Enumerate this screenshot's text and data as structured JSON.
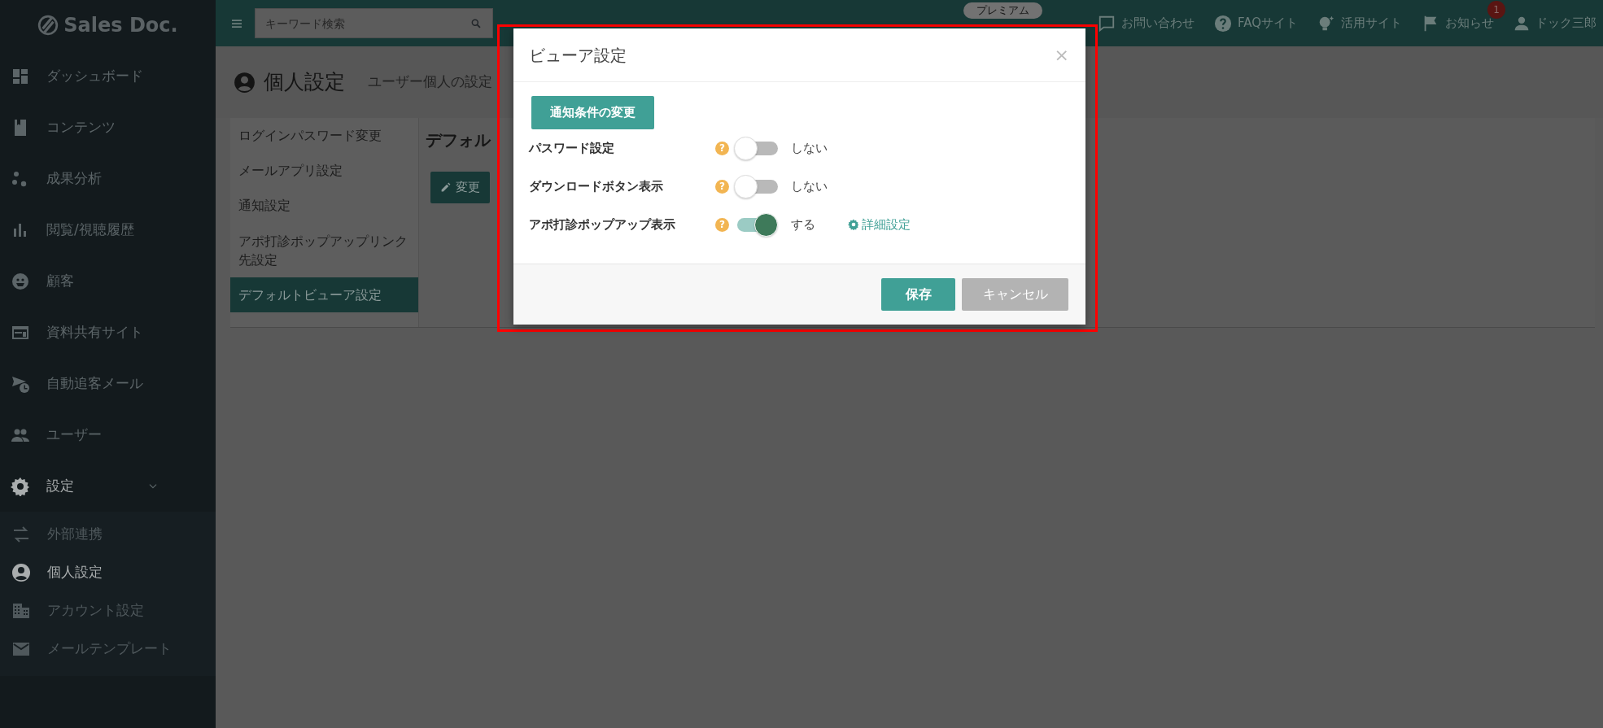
{
  "sidebar": {
    "logo": "Sales Doc.",
    "items": [
      {
        "label": "ダッシュボード"
      },
      {
        "label": "コンテンツ"
      },
      {
        "label": "成果分析"
      },
      {
        "label": "閲覧/視聴履歴"
      },
      {
        "label": "顧客"
      },
      {
        "label": "資料共有サイト"
      },
      {
        "label": "自動追客メール"
      },
      {
        "label": "ユーザー"
      }
    ],
    "settings": {
      "label": "設定",
      "expanded": true,
      "children": [
        {
          "label": "外部連携",
          "selected": false
        },
        {
          "label": "個人設定",
          "selected": true
        },
        {
          "label": "アカウント設定",
          "selected": false
        },
        {
          "label": "メールテンプレート",
          "selected": false
        }
      ]
    }
  },
  "topbar": {
    "search": {
      "placeholder": "キーワード検索"
    },
    "plan": "プレミアム",
    "links": [
      {
        "label": "お問い合わせ"
      },
      {
        "label": "FAQサイト"
      },
      {
        "label": "活用サイト"
      },
      {
        "label": "お知らせ",
        "badge": "1"
      }
    ],
    "user": "ドック三郎"
  },
  "page": {
    "title": "個人設定",
    "subtitle": "ユーザー個人の設定",
    "menu": [
      {
        "label": "ログインパスワード変更",
        "selected": false
      },
      {
        "label": "メールアプリ設定",
        "selected": false
      },
      {
        "label": "通知設定",
        "selected": false
      },
      {
        "label": "アポ打診ポップアップリンク先設定",
        "selected": false
      },
      {
        "label": "デフォルトビューア設定",
        "selected": true
      }
    ],
    "panel_title": "デフォル",
    "panel_button": "変更"
  },
  "modal": {
    "title": "ビューア設定",
    "close": "×",
    "action_button": "通知条件の変更",
    "rows": [
      {
        "label": "パスワード設定",
        "help": "?",
        "on": false,
        "state": "しない"
      },
      {
        "label": "ダウンロードボタン表示",
        "help": "?",
        "on": false,
        "state": "しない"
      },
      {
        "label": "アポ打診ポップアップ表示",
        "help": "?",
        "on": true,
        "state": "する",
        "link": "詳細設定"
      }
    ],
    "buttons": [
      {
        "label": "保存",
        "kind": "primary"
      },
      {
        "label": "キャンセル",
        "kind": "secondary"
      }
    ]
  },
  "highlight": true
}
